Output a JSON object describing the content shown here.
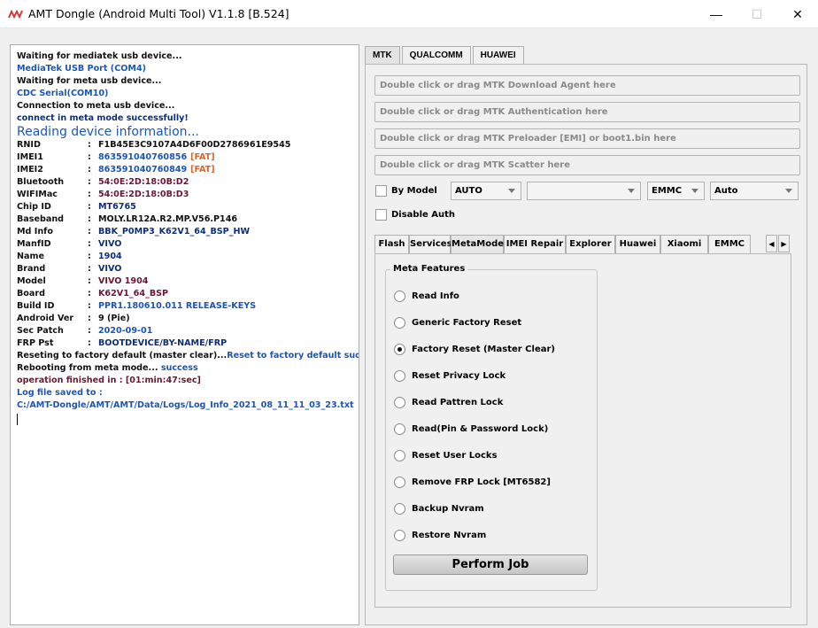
{
  "window": {
    "title": "AMT Dongle (Android Multi Tool) V1.1.8 [B.524]",
    "minimize_glyph": "—",
    "maximize_glyph": "☐",
    "close_glyph": "✕"
  },
  "log": {
    "intro": [
      {
        "text": "Waiting for mediatek usb device...",
        "color": "black"
      },
      {
        "text": "MediaTek USB Port (COM4)",
        "color": "blue"
      },
      {
        "text": "Waiting for meta usb device...",
        "color": "black"
      },
      {
        "text": "CDC Serial(COM10)",
        "color": "blue"
      },
      {
        "text": "Connection to meta usb device...",
        "color": "black"
      },
      {
        "text": "connect in meta mode successfully!",
        "color": "navy"
      }
    ],
    "reading_heading": "Reading device information...",
    "separator": ":",
    "fields": [
      {
        "key": "RNID",
        "value": "F1B45E3C9107A4D6F00D2786961E9545",
        "color": "black"
      },
      {
        "key": "IMEI1",
        "value": "863591040760856",
        "color": "blue",
        "suffix": "[FAT]"
      },
      {
        "key": "IMEI2",
        "value": "863591040760849",
        "color": "blue",
        "suffix": "[FAT]"
      },
      {
        "key": "Bluetooth",
        "value": "54:0E:2D:18:0B:D2",
        "color": "maroon"
      },
      {
        "key": "WIFIMac",
        "value": "54:0E:2D:18:0B:D3",
        "color": "maroon"
      },
      {
        "key": "Chip ID",
        "value": "MT6765",
        "color": "navy"
      },
      {
        "key": "Baseband",
        "value": "MOLY.LR12A.R2.MP.V56.P146",
        "color": "black"
      },
      {
        "key": "Md Info",
        "value": "BBK_P0MP3_K62V1_64_BSP_HW",
        "color": "navy"
      },
      {
        "key": "ManfID",
        "value": "VIVO",
        "color": "navy"
      },
      {
        "key": "Name",
        "value": "1904",
        "color": "navy"
      },
      {
        "key": "Brand",
        "value": "VIVO",
        "color": "navy"
      },
      {
        "key": "Model",
        "value": "VIVO 1904",
        "color": "maroon"
      },
      {
        "key": "Board",
        "value": "K62V1_64_BSP",
        "color": "maroon"
      },
      {
        "key": "Build ID",
        "value": "PPR1.180610.011 RELEASE-KEYS",
        "color": "blue"
      },
      {
        "key": "Android Ver",
        "value": "9 (Pie)",
        "color": "black"
      },
      {
        "key": "Sec Patch",
        "value": "2020-09-01",
        "color": "blue"
      },
      {
        "key": "FRP Pst",
        "value": "BOOTDEVICE/BY-NAME/FRP",
        "color": "navy"
      }
    ],
    "reset_line": {
      "prefix": "Reseting to factory default (master clear)...",
      "result": "Reset to factory default success"
    },
    "reboot_line": {
      "prefix": "Rebooting from meta mode... ",
      "result": "success"
    },
    "finished_line": "operation finished in : [01:min:47:sec]",
    "saved_label": "Log file saved to :",
    "saved_path": "C:/AMT-Dongle/AMT/AMT/Data/Logs/Log_Info_2021_08_11_11_03_23.txt"
  },
  "top_tabs": [
    "MTK",
    "QUALCOMM",
    "HUAWEI"
  ],
  "active_top_tab": "MTK",
  "file_inputs": [
    "Double click or drag MTK Download Agent here",
    "Double click or drag MTK Authentication here",
    "Double click or drag MTK Preloader [EMI] or boot1.bin here",
    "Double click or drag MTK Scatter here"
  ],
  "by_model": {
    "label": "By Model",
    "checked": false
  },
  "disable_auth": {
    "label": "Disable Auth",
    "checked": false
  },
  "selects": {
    "model": "AUTO",
    "blank": "",
    "storage": "EMMC",
    "mode": "Auto"
  },
  "inner_tabs": [
    "Flash",
    "Services",
    "MetaMode",
    "IMEI Repair",
    "Explorer",
    "Huawei",
    "Xiaomi",
    "EMMC"
  ],
  "active_inner_tab": "MetaMode",
  "tab_scroll": {
    "left": "◀",
    "right": "▶"
  },
  "meta_features": {
    "title": "Meta Features",
    "options": [
      "Read Info",
      "Generic Factory Reset",
      "Factory Reset (Master Clear)",
      "Reset Privacy Lock",
      "Read Pattren Lock",
      "Read(Pin & Password Lock)",
      "Reset User Locks",
      "Remove FRP Lock [MT6582]",
      "Backup Nvram",
      "Restore Nvram"
    ],
    "selected": "Factory Reset (Master Clear)"
  },
  "perform_button": "Perform Job",
  "colors": {
    "black": "#111111",
    "blue": "#1a56b8",
    "navy": "#0b2f7a",
    "orange": "#d9652b",
    "maroon": "#6c1636",
    "app_icon": "#d23a3a"
  }
}
